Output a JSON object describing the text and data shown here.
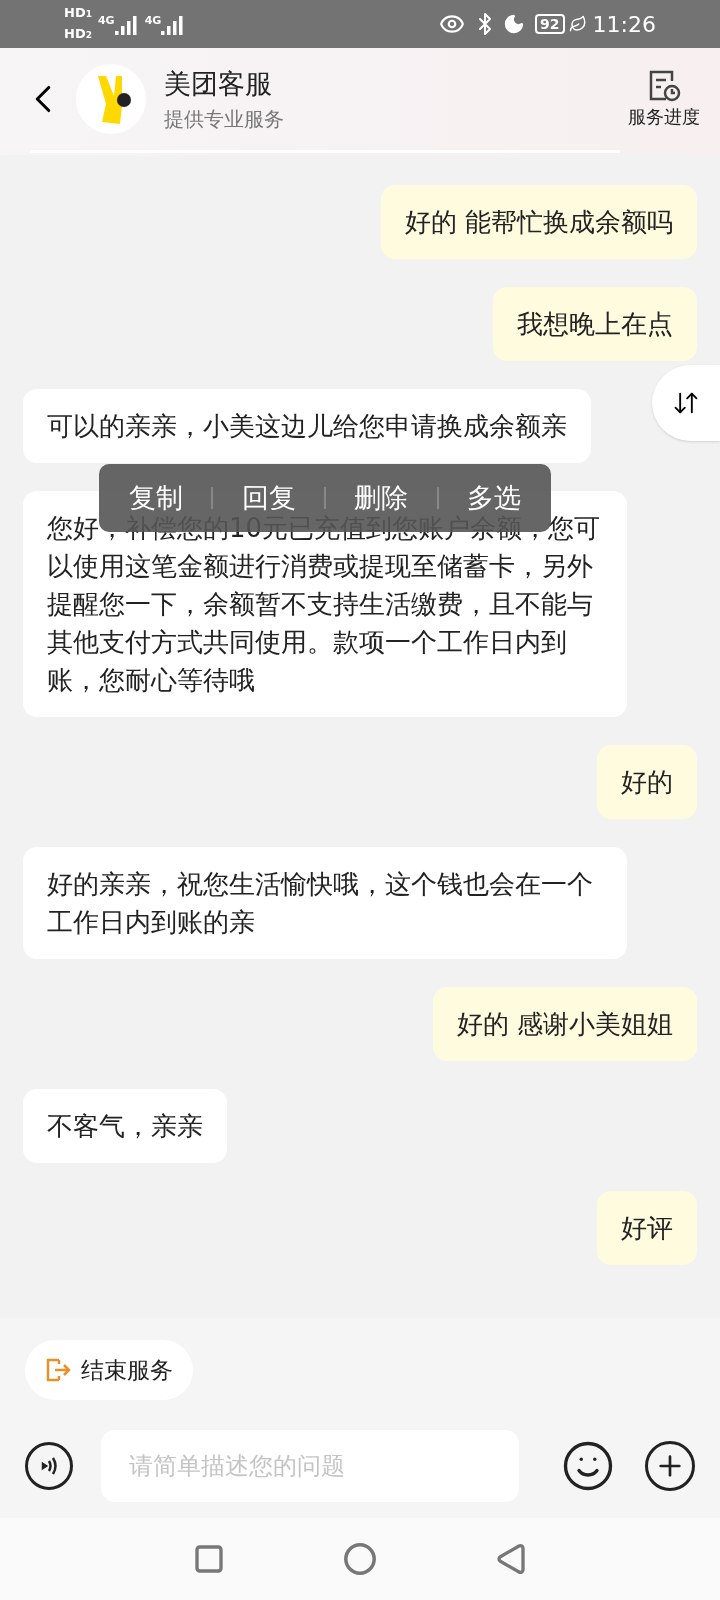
{
  "status_bar": {
    "sims": [
      {
        "label": "HD",
        "slot": "1"
      },
      {
        "label": "HD",
        "slot": "2"
      }
    ],
    "networks": [
      "4G",
      "4G"
    ],
    "battery": "92",
    "time": "11:26"
  },
  "header": {
    "title": "美团客服",
    "subtitle": "提供专业服务",
    "action": "服务进度"
  },
  "messages": [
    {
      "kind": "user",
      "text": "好的 能帮忙换成余额吗"
    },
    {
      "kind": "user",
      "text": "我想晚上在点"
    },
    {
      "kind": "agent",
      "text": "可以的亲亲，小美这边儿给您申请换成余额亲"
    },
    {
      "kind": "agent",
      "text": "您好，补偿您的10元已充值到您账户余额，您可以使用这笔金额进行消费或提现至储蓄卡，另外提醒您一下，余额暂不支持生活缴费，且不能与其他支付方式共同使用。款项一个工作日内到账，您耐心等待哦"
    },
    {
      "kind": "user",
      "text": "好的"
    },
    {
      "kind": "agent",
      "text": "好的亲亲，祝您生活愉快哦，这个钱也会在一个工作日内到账的亲"
    },
    {
      "kind": "user",
      "text": "好的 感谢小美姐姐"
    },
    {
      "kind": "agent",
      "text": "不客气，亲亲"
    },
    {
      "kind": "user",
      "text": "好评"
    }
  ],
  "context_menu": [
    "复制",
    "回复",
    "删除",
    "多选"
  ],
  "end_service": "结束服务",
  "input": {
    "placeholder": "请简单描述您的问题"
  }
}
